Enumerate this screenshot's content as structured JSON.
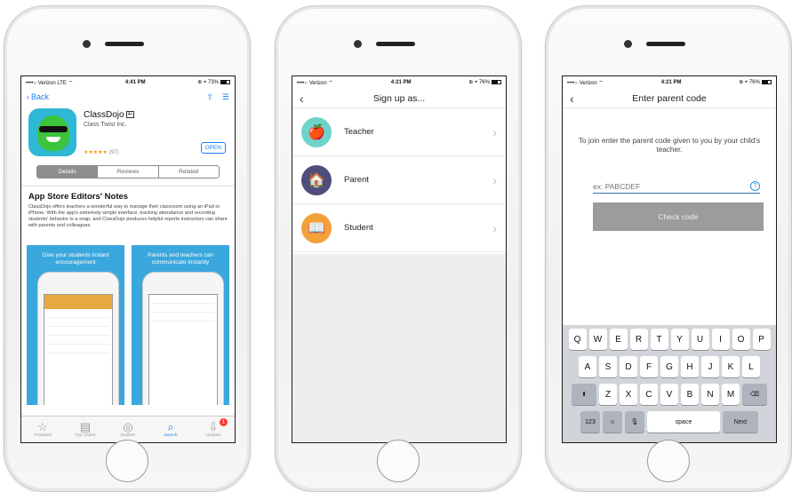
{
  "phone1": {
    "status": {
      "carrier": "••••○ Verizon  LTE ⌔",
      "time": "4:41 PM",
      "right": "⊕ ⌖ 73%"
    },
    "nav": {
      "back": "Back"
    },
    "app": {
      "name": "ClassDojo",
      "age": "4+",
      "developer": "Class Twist Inc.",
      "stars": "★★★★★",
      "rating_count": "(97)",
      "open": "OPEN"
    },
    "segments": [
      "Details",
      "Reviews",
      "Related"
    ],
    "notes": {
      "title": "App Store Editors' Notes",
      "body": "ClassDojo offers teachers a wonderful way to manage their classroom using an iPad or iPhone. With the app's extremely simple interface, tracking attendance and recording students' behavior is a snap, and ClassDojo produces helpful reports instructors can share with parents and colleagues."
    },
    "shots": [
      {
        "caption": "Give your students instant encouragement"
      },
      {
        "caption": "Parents and teachers can communicate instantly"
      }
    ],
    "tabs": [
      {
        "label": "Featured",
        "icon": "☆"
      },
      {
        "label": "Top Charts",
        "icon": "▤"
      },
      {
        "label": "Explore",
        "icon": "◎"
      },
      {
        "label": "Search",
        "icon": "⌕"
      },
      {
        "label": "Updates",
        "icon": "⇩",
        "badge": "1"
      }
    ]
  },
  "phone2": {
    "status": {
      "carrier": "••••○ Verizon ⌔",
      "time": "4:21 PM",
      "right": "⊕ ⌖ 76%"
    },
    "title": "Sign up as...",
    "roles": [
      {
        "label": "Teacher",
        "icon": "🍎",
        "color": "#6fd3c8"
      },
      {
        "label": "Parent",
        "icon": "🏠",
        "color": "#4d4e7c"
      },
      {
        "label": "Student",
        "icon": "📖",
        "color": "#f3a13a"
      }
    ]
  },
  "phone3": {
    "status": {
      "carrier": "••••○ Verizon ⌔",
      "time": "4:21 PM",
      "right": "⊕ ⌖ 76%"
    },
    "title": "Enter parent code",
    "prompt": "To join enter the parent code given to you by your child's teacher.",
    "code_placeholder": "ex: PABCDEF",
    "help": "?",
    "check": "Check code",
    "keyboard": {
      "row1": [
        "Q",
        "W",
        "E",
        "R",
        "T",
        "Y",
        "U",
        "I",
        "O",
        "P"
      ],
      "row2": [
        "A",
        "S",
        "D",
        "F",
        "G",
        "H",
        "J",
        "K",
        "L"
      ],
      "row3": [
        "Z",
        "X",
        "C",
        "V",
        "B",
        "N",
        "M"
      ],
      "shift": "⬆",
      "delete": "⌫",
      "num": "123",
      "emoji": "☺",
      "mic": "🎙",
      "space": "space",
      "next": "Next"
    }
  }
}
